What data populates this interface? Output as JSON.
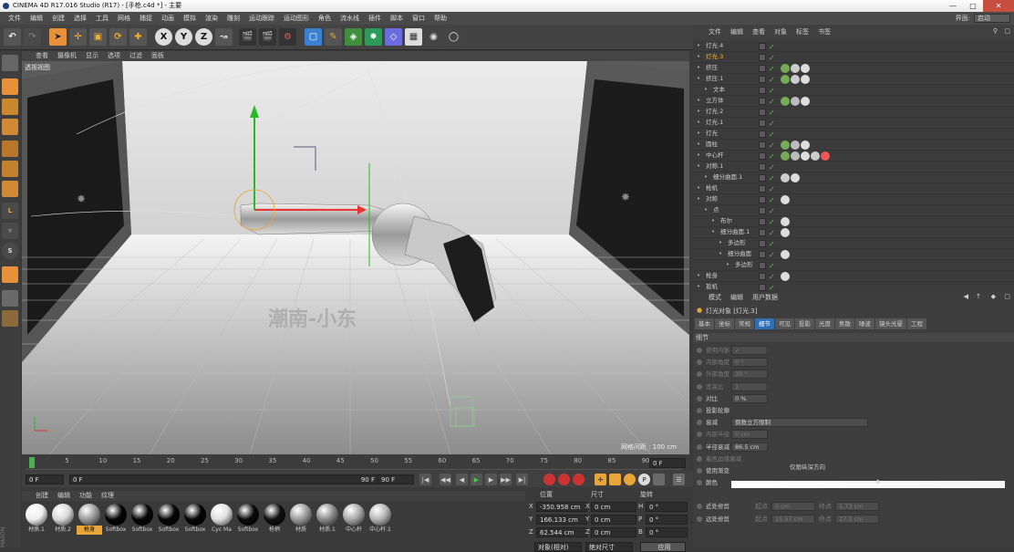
{
  "window": {
    "title": "CINEMA 4D R17.016 Studio (R17) - [手枪.c4d *] - 主要"
  },
  "menubar": {
    "items": [
      "文件",
      "编辑",
      "创建",
      "选择",
      "工具",
      "网格",
      "捕捉",
      "动画",
      "模拟",
      "渲染",
      "雕刻",
      "运动跟踪",
      "运动图形",
      "角色",
      "流水线",
      "插件",
      "脚本",
      "窗口",
      "帮助"
    ],
    "layout_label": "界面:",
    "layout_value": "启动"
  },
  "viewport": {
    "menu": [
      "查看",
      "摄像机",
      "显示",
      "选项",
      "过滤",
      "面板"
    ],
    "label": "透视视图",
    "grid_label": "网格间距 : 100 cm",
    "watermark": "潮南-小东"
  },
  "timeline": {
    "ticks": [
      "0",
      "5",
      "10",
      "15",
      "20",
      "25",
      "30",
      "35",
      "40",
      "45",
      "50",
      "55",
      "60",
      "65",
      "70",
      "75",
      "80",
      "85",
      "90"
    ],
    "end_frame": "0 F",
    "start_field": "0 F",
    "range_start": "0 F",
    "range_end": "90 F",
    "max_field": "90 F"
  },
  "materials": {
    "menu": [
      "创建",
      "编辑",
      "功能",
      "纹理"
    ],
    "items": [
      {
        "name": "材质.1",
        "color": "#eeeeee",
        "highlight": false
      },
      {
        "name": "材质.2",
        "color": "#d9d9d9",
        "highlight": false
      },
      {
        "name": "枪身",
        "color": "#9a9a9a",
        "highlight": true
      },
      {
        "name": "Softbox",
        "color": "#050505",
        "highlight": false
      },
      {
        "name": "Softbox",
        "color": "#050505",
        "highlight": false
      },
      {
        "name": "Softbox",
        "color": "#050505",
        "highlight": false
      },
      {
        "name": "Softbox",
        "color": "#050505",
        "highlight": false
      },
      {
        "name": "Cyc Ma",
        "color": "#e0e0e0",
        "highlight": false
      },
      {
        "name": "Softbox",
        "color": "#0a0a0a",
        "highlight": false
      },
      {
        "name": "枪柄",
        "color": "#101010",
        "highlight": false
      },
      {
        "name": "材质",
        "color": "#9c9c9c",
        "highlight": false
      },
      {
        "name": "材质.1",
        "color": "#8a8a8a",
        "highlight": false
      },
      {
        "name": "中心杆",
        "color": "#a8a8a8",
        "highlight": false
      },
      {
        "name": "中心杆.1",
        "color": "#b5b5b5",
        "highlight": false
      }
    ]
  },
  "coordinates": {
    "headers": [
      "位置",
      "尺寸",
      "旋转"
    ],
    "rows": [
      {
        "axis": "X",
        "pos": "-350.958 cm",
        "size": "0 cm",
        "rot_axis": "H",
        "rot": "0 °"
      },
      {
        "axis": "Y",
        "pos": "166.133 cm",
        "size": "0 cm",
        "rot_axis": "P",
        "rot": "0 °"
      },
      {
        "axis": "Z",
        "pos": "62.544 cm",
        "size": "0 cm",
        "rot_axis": "B",
        "rot": "0 °"
      }
    ],
    "mode": "对象(相对)",
    "size_mode": "绝对尺寸",
    "apply": "应用"
  },
  "objects": {
    "menu": [
      "文件",
      "编辑",
      "查看",
      "对象",
      "标签",
      "书签"
    ],
    "rows": [
      {
        "name": "灯光.4",
        "indent": 0,
        "selected": false,
        "tags": []
      },
      {
        "name": "灯光.3",
        "indent": 0,
        "selected": true,
        "tags": []
      },
      {
        "name": "挤压",
        "indent": 0,
        "selected": false,
        "tags": [
          "#7a5",
          "#ccc",
          "#ddd"
        ]
      },
      {
        "name": "挤压.1",
        "indent": 0,
        "selected": false,
        "tags": [
          "#7a5",
          "#ccc",
          "#ddd"
        ]
      },
      {
        "name": "文本",
        "indent": 1,
        "selected": false,
        "tags": []
      },
      {
        "name": "立方体",
        "indent": 0,
        "selected": false,
        "tags": [
          "#7a5",
          "#bbb",
          "#ddd"
        ]
      },
      {
        "name": "灯光.2",
        "indent": 0,
        "selected": false,
        "tags": []
      },
      {
        "name": "灯光.1",
        "indent": 0,
        "selected": false,
        "tags": []
      },
      {
        "name": "灯光",
        "indent": 0,
        "selected": false,
        "tags": []
      },
      {
        "name": "圆柱",
        "indent": 0,
        "selected": false,
        "tags": [
          "#7a5",
          "#bbb",
          "#ddd"
        ]
      },
      {
        "name": "中心杆",
        "indent": 0,
        "selected": false,
        "tags": [
          "#7a5",
          "#bbb",
          "#ddd",
          "#ccc",
          "#e55"
        ]
      },
      {
        "name": "对称.1",
        "indent": 0,
        "selected": false,
        "tags": []
      },
      {
        "name": "细分曲面.1",
        "indent": 1,
        "selected": false,
        "tags": [
          "#ccc",
          "#ddd"
        ]
      },
      {
        "name": "枪机",
        "indent": 0,
        "selected": false,
        "tags": []
      },
      {
        "name": "对称",
        "indent": 0,
        "selected": false,
        "tags": [
          "#ddd"
        ]
      },
      {
        "name": "点",
        "indent": 1,
        "selected": false,
        "tags": []
      },
      {
        "name": "布尔",
        "indent": 2,
        "selected": false,
        "tags": [
          "#ddd"
        ]
      },
      {
        "name": "细分曲面.1",
        "indent": 2,
        "selected": false,
        "tags": [
          "#ddd"
        ]
      },
      {
        "name": "多边形",
        "indent": 3,
        "selected": false,
        "tags": []
      },
      {
        "name": "细分曲面",
        "indent": 3,
        "selected": false,
        "tags": [
          "#ddd"
        ]
      },
      {
        "name": "多边形",
        "indent": 4,
        "selected": false,
        "tags": []
      },
      {
        "name": "枪身",
        "indent": 0,
        "selected": false,
        "tags": [
          "#ddd"
        ]
      },
      {
        "name": "扳机",
        "indent": 0,
        "selected": false,
        "tags": []
      }
    ]
  },
  "attributes": {
    "menu": [
      "模式",
      "编辑",
      "用户数据"
    ],
    "title": "灯光对象 [灯光.3]",
    "tabs": [
      "基本",
      "坐标",
      "常规",
      "细节",
      "可见",
      "投影",
      "光度",
      "焦散",
      "噪波",
      "镜头光晕",
      "工程"
    ],
    "active_tab": "细节",
    "section": "细节",
    "rows": [
      {
        "label": "使用内部",
        "value": "✓",
        "dim": true
      },
      {
        "label": "内部角度",
        "value": "0 °",
        "dim": true
      },
      {
        "label": "外部角度",
        "value": "30 °",
        "dim": true
      },
      {
        "label": "宽高比",
        "value": "1",
        "dim": true
      },
      {
        "label": "对比",
        "value": "0 %",
        "dim": false
      },
      {
        "label": "投影轮廓",
        "value": "",
        "dim": false
      },
      {
        "label": "衰减",
        "value": "倒数立方限制",
        "dim": false
      },
      {
        "label": "内部半径",
        "value": "0 cm",
        "dim": true
      },
      {
        "label": "半径衰减",
        "value": "86.5 cm",
        "dim": false
      },
      {
        "label": "着色边缘衰减",
        "value": "",
        "dim": true
      },
      {
        "label": "使用渐变",
        "value": "",
        "dim": false
      },
      {
        "label": "颜色",
        "value": "",
        "dim": false
      }
    ],
    "extra_only_z": "仅限纵深方向",
    "near_clip": "近处修剪",
    "far_clip": "远处修剪",
    "start": "起点",
    "end": "终点",
    "near_start": "0 cm",
    "near_end": "1.73 cm",
    "far_start": "15.57 cm",
    "far_end": "17.3 cm"
  }
}
